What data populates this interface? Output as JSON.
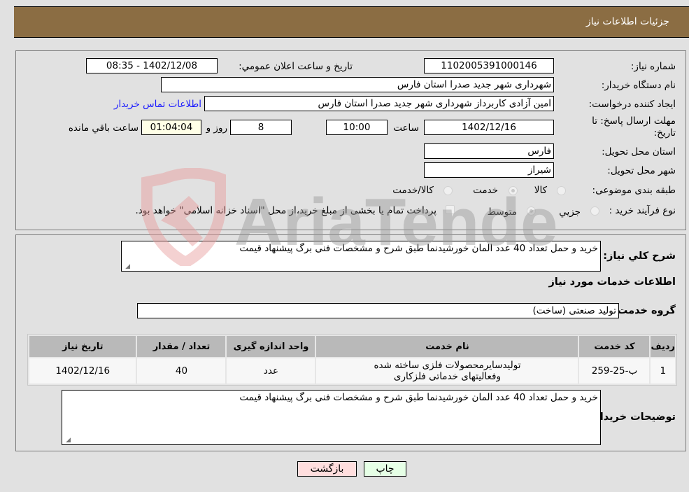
{
  "header": {
    "title": "جزئیات اطلاعات نیاز"
  },
  "form": {
    "need_number": {
      "label": "شماره نیاز:",
      "value": "1102005391000146"
    },
    "announce_datetime": {
      "label": "تاریخ و ساعت اعلان عمومي:",
      "value": "1402/12/08 - 08:35"
    },
    "buyer_org": {
      "label": "نام دستگاه خریدار:",
      "value": "شهرداری شهر جدید صدرا استان فارس"
    },
    "requester": {
      "label": "ایجاد کننده درخواست:",
      "value": "امین آزادی کاربرداز شهرداری شهر جدید صدرا استان فارس"
    },
    "buyer_contact_link": "اطلاعات تماس خریدار",
    "deadline": {
      "label": "مهلت ارسال پاسخ: تا تاریخ:",
      "date": "1402/12/16",
      "time_label": "ساعت",
      "time": "10:00",
      "days": "8",
      "days_label": "روز و",
      "remaining": "01:04:04",
      "remaining_label": "ساعت باقي مانده"
    },
    "delivery_province": {
      "label": "استان محل تحویل:",
      "value": "فارس"
    },
    "delivery_city": {
      "label": "شهر محل تحویل:",
      "value": "شیراز"
    },
    "category": {
      "label": "طبقه بندی موضوعی:",
      "options": [
        "کالا",
        "خدمت",
        "کالا/خدمت"
      ],
      "selected": "خدمت"
    },
    "purchase_type": {
      "label": "نوع فرآیند خرید :",
      "options": [
        "جزيي",
        "متوسط"
      ],
      "selected": "متوسط",
      "treasury_note": "پرداخت تمام یا بخشی از مبلغ خرید،از محل \"اسناد خزانه اسلامی\" خواهد بود."
    }
  },
  "details": {
    "general_desc_label": "شرح کلي نیاز:",
    "general_desc": "خرید و حمل تعداد 40 عدد المان خورشیدنما طبق شرح و مشخصات فنی برگ پیشنهاد قیمت",
    "services_heading": "اطلاعات خدمات مورد نیاز",
    "service_group_label": "گروه خدمت:",
    "service_group": "تولید صنعتی (ساخت)",
    "table": {
      "headers": [
        "ردیف",
        "کد خدمت",
        "نام خدمت",
        "واحد اندازه گیری",
        "تعداد / مقدار",
        "تاریخ نیاز"
      ],
      "rows": [
        [
          "1",
          "ب-25-259",
          "تولیدسایرمحصولات فلزی ساخته شده وفعالیتهای خدماتی فلزکاری",
          "عدد",
          "40",
          "1402/12/16"
        ]
      ]
    },
    "buyer_notes_label": "توضیحات خریدار:",
    "buyer_notes": "خرید و حمل تعداد 40 عدد المان خورشیدنما طبق شرح و مشخصات فنی برگ پیشنهاد قیمت"
  },
  "buttons": {
    "print": "چاپ",
    "back": "بازگشت"
  },
  "watermark": {
    "text": "AriaTender.neT"
  },
  "colors": {
    "header": "#8b6d43",
    "link": "#1a1aff",
    "back_button": "#ffdede",
    "print_button": "#e6ffe6",
    "remaining_field": "#ffffe7"
  }
}
